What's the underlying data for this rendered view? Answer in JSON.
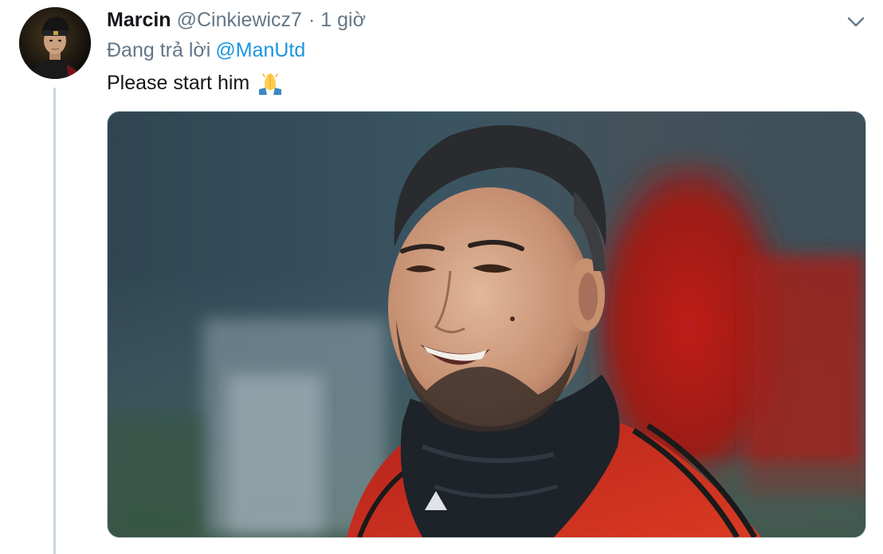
{
  "tweet": {
    "author_name": "Marcin",
    "author_handle": "@Cinkiewicz7",
    "separator": "·",
    "time": "1 giờ",
    "reply_prefix": "Đang trả lời",
    "reply_mention": "@ManUtd",
    "text": "Please start him",
    "emoji": "folded-hands-emoji",
    "media_type": "photo"
  },
  "icons": {
    "menu": "chevron-down-icon"
  },
  "colors": {
    "name": "#14171a",
    "secondary": "#657786",
    "link": "#1b95e0",
    "thread_line": "#c9d6df",
    "media_border": "#ccd6dd"
  }
}
